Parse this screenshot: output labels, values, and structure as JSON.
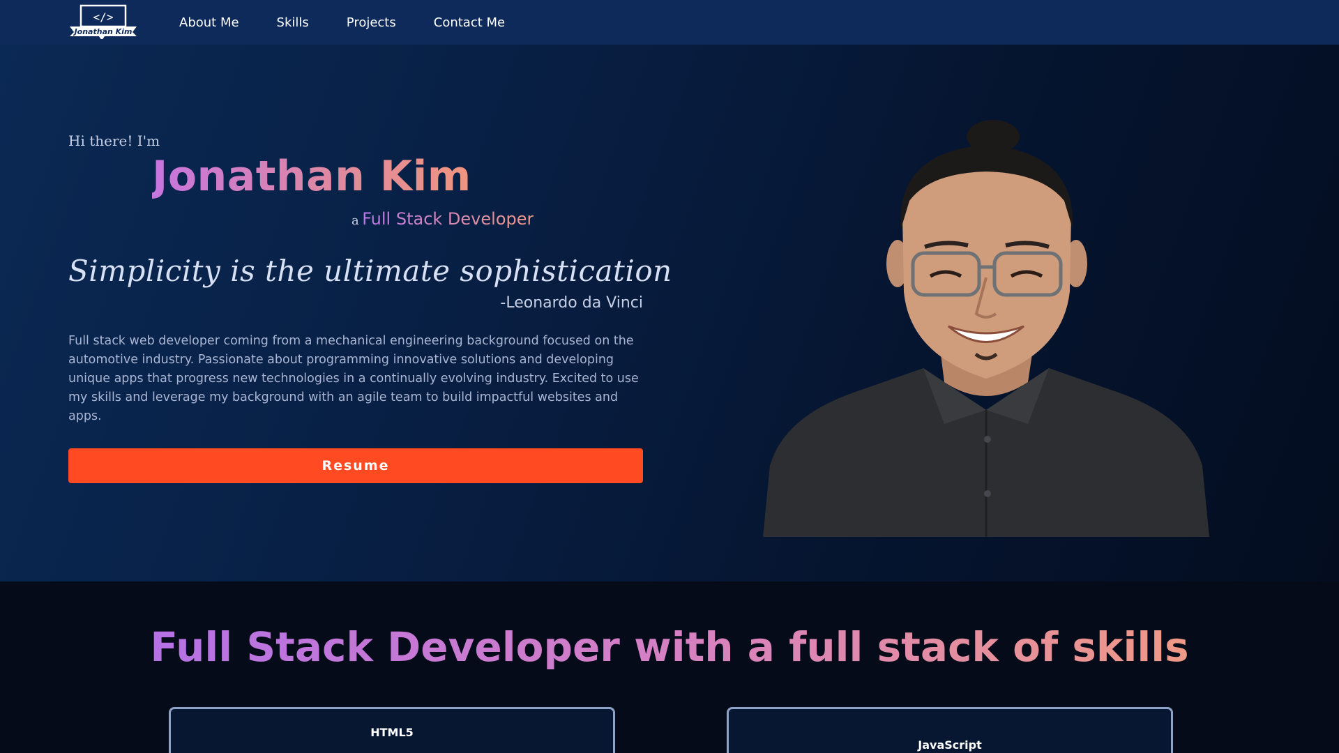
{
  "nav": {
    "logo_text": "Jonathan Kim",
    "logo_code": "</>",
    "links": [
      {
        "label": "About Me"
      },
      {
        "label": "Skills"
      },
      {
        "label": "Projects"
      },
      {
        "label": "Contact Me"
      }
    ]
  },
  "hero": {
    "greeting": "Hi there! I'm",
    "name": "Jonathan Kim",
    "role_prefix": "a",
    "role": "Full Stack Developer",
    "quote": "Simplicity is the ultimate sophistication",
    "quote_author": "-Leonardo da Vinci",
    "bio": "Full stack web developer coming from a mechanical engineering background focused on the automotive industry. Passionate about programming innovative solutions and developing unique apps that progress new technologies in a continually evolving industry. Excited to use my skills and leverage my background with an agile team to build impactful websites and apps.",
    "resume_label": "Resume"
  },
  "skills": {
    "title": "Full Stack Developer with a full stack of skills",
    "cards": [
      {
        "name": "HTML5"
      },
      {
        "name": "JavaScript"
      }
    ]
  },
  "colors": {
    "nav_bg": "#0d2a5a",
    "accent": "#ff4a22",
    "gradient_start": "#c775e0",
    "gradient_end": "#f0957e"
  }
}
